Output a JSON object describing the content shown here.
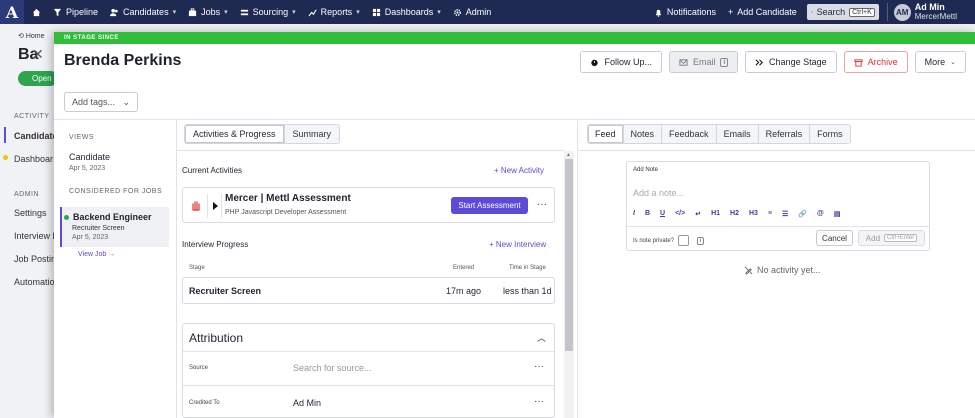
{
  "nav": {
    "logo": "A",
    "items": [
      {
        "label": "Pipeline",
        "icon": "filter-icon",
        "caret": false
      },
      {
        "label": "Candidates",
        "icon": "users-icon",
        "caret": true
      },
      {
        "label": "Jobs",
        "icon": "briefcase-icon",
        "caret": true
      },
      {
        "label": "Sourcing",
        "icon": "sourcing-icon",
        "caret": true
      },
      {
        "label": "Reports",
        "icon": "chart-icon",
        "caret": true
      },
      {
        "label": "Dashboards",
        "icon": "dashboard-icon",
        "caret": true
      },
      {
        "label": "Admin",
        "icon": "gear-icon",
        "caret": false
      }
    ],
    "notifications": "Notifications",
    "add_candidate": "Add Candidate",
    "search_placeholder": "Search",
    "search_shortcut": "Ctrl+K",
    "avatar_initials": "AM",
    "user_name": "Ad Min",
    "user_org": "MercerMettl"
  },
  "background": {
    "breadcrumb": "Home",
    "title": "Ba",
    "status_pill": "Open",
    "activity_section": "ACTIVITY",
    "admin_section": "ADMIN",
    "links": [
      "Candidate",
      "Dashboar",
      "Settings",
      "Interview F",
      "Job Posting",
      "Automatio"
    ]
  },
  "modal": {
    "stage_banner": "IN STAGE SINCE",
    "candidate_name": "Brenda Perkins",
    "actions": {
      "follow_up": "Follow Up...",
      "email": "Email",
      "email_badge": "i",
      "change_stage": "Change Stage",
      "archive": "Archive",
      "more": "More"
    },
    "add_tags": "Add tags...",
    "views_label": "VIEWS",
    "view_candidate": "Candidate",
    "view_candidate_date": "Apr 5, 2023",
    "considered_label": "CONSIDERED FOR JOBS",
    "job": {
      "title": "Backend Engineer",
      "stage": "Recruiter Screen",
      "date": "Apr 5, 2023",
      "view_link": "View Job →"
    },
    "tabs": [
      "Activities & Progress",
      "Summary"
    ],
    "current_activities": "Current Activities",
    "new_activity": "+ New Activity",
    "activity": {
      "title": "Mercer | Mettl Assessment",
      "subtitle": "PHP Javascript Developer Assessment",
      "button": "Start Assessment",
      "more": "···"
    },
    "interview_progress": "Interview Progress",
    "new_interview": "+ New Interview",
    "stage_table": {
      "headers": [
        "Stage",
        "Entered",
        "Time in Stage"
      ],
      "row": [
        "Recruiter Screen",
        "17m ago",
        "less than 1d"
      ]
    },
    "attribution": {
      "title": "Attribution",
      "source_label": "Source",
      "source_placeholder": "Search for source...",
      "credited_label": "Credited To",
      "credited_value": "Ad Min",
      "more": "···"
    },
    "feed_tabs": [
      "Feed",
      "Notes",
      "Feedback",
      "Emails",
      "Referrals",
      "Forms"
    ],
    "note": {
      "label": "Add Note",
      "placeholder": "Add a note...",
      "format_tools": [
        "I",
        "B",
        "U",
        "</>",
        "↵",
        "H1",
        "H2",
        "H3",
        "≡",
        "☰",
        "🔗",
        "@",
        "▤"
      ],
      "private_label": "Is note private?",
      "private_info": "i",
      "cancel": "Cancel",
      "add": "Add",
      "add_shortcut": "Ctrl+Enter"
    },
    "no_activity": "No activity yet..."
  }
}
